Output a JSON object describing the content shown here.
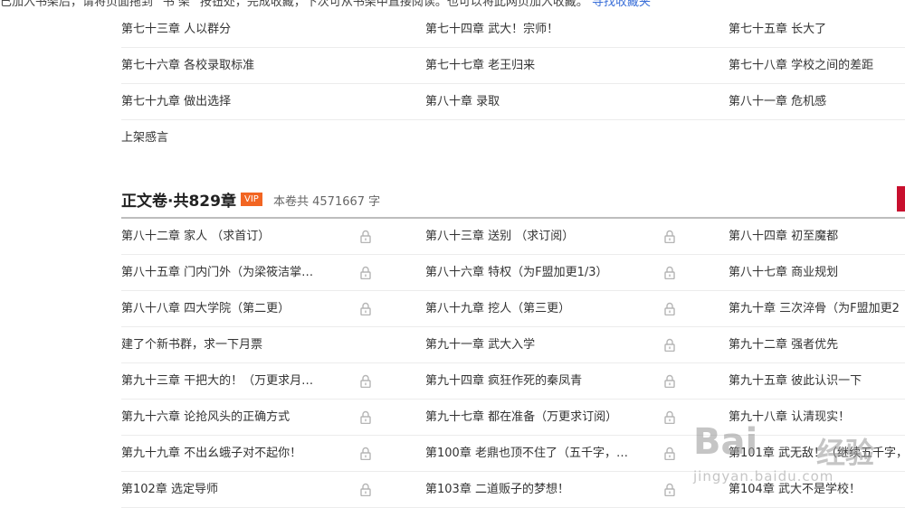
{
  "top_hint": {
    "text": "已加入书架后，请将页面拖到 “书 架” 按钮处，完成收藏，下次可从书架中直接阅读。也可以将此网页加入收藏。",
    "link": "寻找收藏夹"
  },
  "previous_volume": {
    "rows": [
      [
        "第七十三章 人以群分",
        "第七十四章 武大！宗师！",
        "第七十五章 长大了"
      ],
      [
        "第七十六章 各校录取标准",
        "第七十七章 老王归来",
        "第七十八章 学校之间的差距"
      ],
      [
        "第七十九章 做出选择",
        "第八十章 录取",
        "第八十一章 危机感"
      ],
      [
        "上架感言",
        "",
        ""
      ]
    ]
  },
  "volume": {
    "title": "正文卷·共829章",
    "badge": "VIP",
    "info": "本卷共 4571667 字",
    "rows": [
      [
        "第八十二章 家人 （求首订）",
        "第八十三章 送别 （求订阅）",
        "第八十四章 初至魔都"
      ],
      [
        "第八十五章 门内门外（为梁筱洁掌…",
        "第八十六章 特权（为F盟加更1/3）",
        "第八十七章 商业规划"
      ],
      [
        "第八十八章 四大学院（第二更）",
        "第八十九章 挖人（第三更）",
        "第九十章 三次淬骨（为F盟加更2"
      ],
      [
        "建了个新书群，求一下月票",
        "第九十一章 武大入学",
        "第九十二章 强者优先"
      ],
      [
        "第九十三章 干把大的！（万更求月…",
        "第九十四章 疯狂作死的秦凤青",
        "第九十五章 彼此认识一下"
      ],
      [
        "第九十六章 论抢风头的正确方式",
        "第九十七章 都在准备（万更求订阅）",
        "第九十八章 认清现实！"
      ],
      [
        "第九十九章 不出幺蛾子对不起你！",
        "第100章 老鼎也顶不住了（五千字，…",
        "第101章 武无敌！（继续五千字，"
      ],
      [
        "第102章 选定导师",
        "第103章 二道贩子的梦想！",
        "第104章 武大不是学校！"
      ]
    ],
    "locks": [
      [
        true,
        true
      ],
      [
        true,
        true
      ],
      [
        true,
        true
      ],
      [
        false,
        true
      ],
      [
        true,
        true
      ],
      [
        true,
        true
      ],
      [
        true,
        true
      ],
      [
        true,
        true
      ]
    ]
  },
  "watermark": {
    "logo": "Bai",
    "cn": "经验",
    "url": "jingyan.baidu.com"
  }
}
